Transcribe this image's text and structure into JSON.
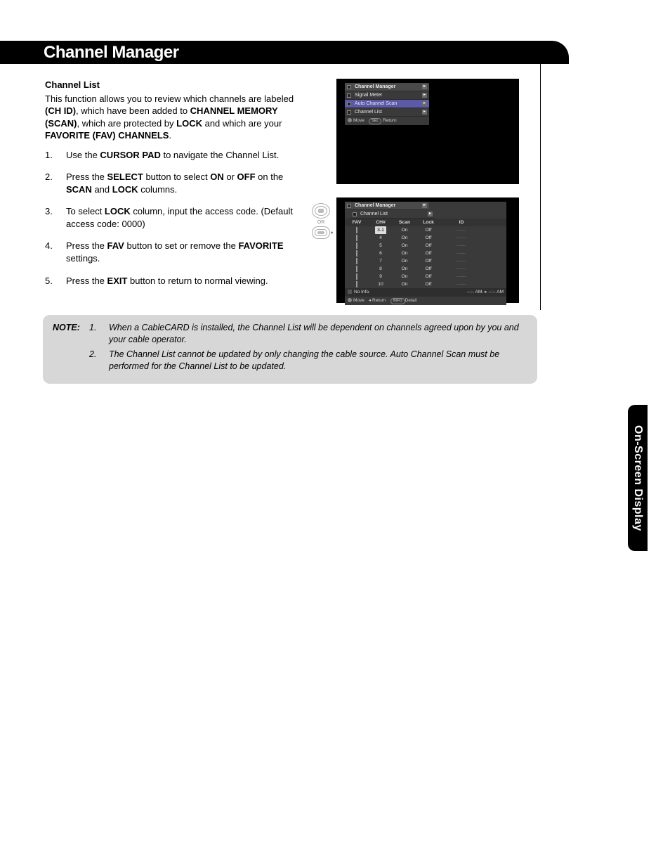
{
  "title": "Channel Manager",
  "sideTab": "On-Screen Display",
  "section": {
    "heading": "Channel List",
    "intro_parts": [
      "This function allows you to review which channels are labeled ",
      "(CH ID)",
      ", which have been added to ",
      "CHANNEL MEMORY (SCAN)",
      ", which are protected by ",
      "LOCK",
      " and which are your ",
      "FAVORITE (FAV) CHANNELS",
      "."
    ],
    "steps": [
      {
        "n": "1.",
        "pre": "Use the ",
        "b1": "CURSOR PAD",
        "post": " to navigate the Channel List."
      },
      {
        "n": "2.",
        "pre": "Press the ",
        "b1": "SELECT",
        "mid": " button to select ",
        "b2": "ON",
        "mid2": " or ",
        "b3": "OFF",
        "mid3": " on the ",
        "b4": "SCAN",
        "mid4": " and ",
        "b5": "LOCK",
        "post": " columns."
      },
      {
        "n": "3.",
        "pre": "To select ",
        "b1": "LOCK",
        "post": " column, input the access code. (Default access code: 0000)"
      },
      {
        "n": "4.",
        "pre": "Press the ",
        "b1": "FAV",
        "mid": " button to set or remove the ",
        "b2": "FAVORITE",
        "post": " settings."
      },
      {
        "n": "5.",
        "pre": "Press the ",
        "b1": "EXIT",
        "post": " button to return to normal viewing."
      }
    ]
  },
  "osd_menu": {
    "title": "Channel Manager",
    "items": [
      "Signal Meter",
      "Auto Channel Scan",
      "Channel List"
    ],
    "hints": {
      "move": "Move",
      "sel": "SEL",
      "ret": "Return"
    }
  },
  "osd_list": {
    "crumb1": "Channel Manager",
    "crumb2": "Channel List",
    "headers": [
      "FAV",
      "CH#",
      "Scan",
      "Lock",
      "ID"
    ],
    "rows": [
      {
        "ch": "3-1",
        "scan": "On",
        "lock": "Off",
        "sel": true
      },
      {
        "ch": "4",
        "scan": "On",
        "lock": "Off"
      },
      {
        "ch": "5",
        "scan": "On",
        "lock": "Off"
      },
      {
        "ch": "6",
        "scan": "On",
        "lock": "Off"
      },
      {
        "ch": "7",
        "scan": "On",
        "lock": "Off"
      },
      {
        "ch": "8",
        "scan": "On",
        "lock": "Off"
      },
      {
        "ch": "9",
        "scan": "On",
        "lock": "Off"
      },
      {
        "ch": "10",
        "scan": "On",
        "lock": "Off"
      }
    ],
    "info": {
      "no": "No Info.",
      "am1": "--:-- AM-",
      "am2": "--:-- AM"
    },
    "hints": {
      "move": "Move",
      "ret": "Return",
      "info": "INFO",
      "detail": "Detail"
    }
  },
  "remote": {
    "or": "OR"
  },
  "note": {
    "lead": "NOTE:",
    "items": [
      {
        "n": "1.",
        "t": "When a CableCARD is installed, the Channel List will be dependent on channels agreed upon by you and your cable operator."
      },
      {
        "n": "2.",
        "t": "The Channel List cannot be updated by only changing the cable source.  Auto Channel Scan must be performed for the Channel List to be updated."
      }
    ]
  }
}
